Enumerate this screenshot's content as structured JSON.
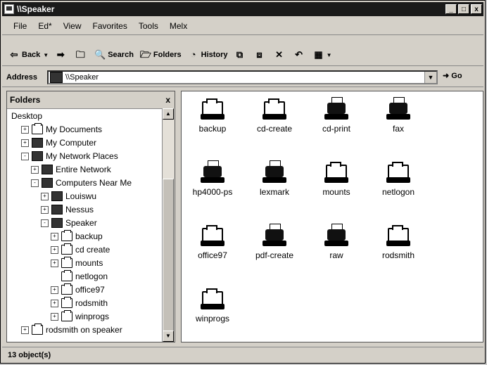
{
  "window": {
    "title": "\\\\Speaker",
    "min": "_",
    "max": "□",
    "close": "x"
  },
  "menu": [
    "File",
    "Ed*",
    "View",
    "Favorites",
    "Tools",
    "Melx"
  ],
  "toolbar": {
    "back": "Back",
    "forward_icon": "forward-arrow",
    "search": "Search",
    "folders": "Folders",
    "history": "History"
  },
  "address": {
    "label": "Address",
    "value": "\\\\Speaker",
    "go": "Go"
  },
  "folders_pane": {
    "title": "Folders",
    "close": "x"
  },
  "tree": [
    {
      "label": "Desktop",
      "icon": "desktop",
      "indent": 0
    },
    {
      "label": "My Documents",
      "icon": "folder",
      "indent": 1,
      "expander": "+"
    },
    {
      "label": "My Computer",
      "icon": "computer",
      "indent": 1,
      "expander": "+"
    },
    {
      "label": "My Network Places",
      "icon": "network",
      "indent": 1,
      "expander": "-"
    },
    {
      "label": "Entire Network",
      "icon": "globe",
      "indent": 2,
      "expander": "+"
    },
    {
      "label": "Computers Near Me",
      "icon": "computer",
      "indent": 2,
      "expander": "-"
    },
    {
      "label": "Louiswu",
      "icon": "computer",
      "indent": 3,
      "expander": "+"
    },
    {
      "label": "Nessus",
      "icon": "computer",
      "indent": 3,
      "expander": "+"
    },
    {
      "label": "Speaker",
      "icon": "computer",
      "indent": 3,
      "expander": "-"
    },
    {
      "label": "backup",
      "icon": "folder",
      "indent": 4,
      "expander": "+"
    },
    {
      "label": "cd create",
      "icon": "folder",
      "indent": 4,
      "expander": "+"
    },
    {
      "label": "mounts",
      "icon": "folder",
      "indent": 4,
      "expander": "+"
    },
    {
      "label": "netlogon",
      "icon": "folder",
      "indent": 4,
      "expander": ""
    },
    {
      "label": "office97",
      "icon": "folder",
      "indent": 4,
      "expander": "+"
    },
    {
      "label": "rodsmith",
      "icon": "folder",
      "indent": 4,
      "expander": "+"
    },
    {
      "label": "winprogs",
      "icon": "folder",
      "indent": 4,
      "expander": "+"
    },
    {
      "label": "rodsmith on speaker",
      "icon": "folder",
      "indent": 1,
      "expander": "+"
    }
  ],
  "items": [
    {
      "label": "backup",
      "type": "share"
    },
    {
      "label": "cd-create",
      "type": "share"
    },
    {
      "label": "cd-print",
      "type": "printer"
    },
    {
      "label": "fax",
      "type": "printer"
    },
    {
      "label": "hp4000-ps",
      "type": "printer"
    },
    {
      "label": "lexmark",
      "type": "printer"
    },
    {
      "label": "mounts",
      "type": "share"
    },
    {
      "label": "netlogon",
      "type": "share"
    },
    {
      "label": "office97",
      "type": "share"
    },
    {
      "label": "pdf-create",
      "type": "printer"
    },
    {
      "label": "raw",
      "type": "printer"
    },
    {
      "label": "rodsmith",
      "type": "share"
    },
    {
      "label": "winprogs",
      "type": "share"
    }
  ],
  "status": "13 object(s)"
}
